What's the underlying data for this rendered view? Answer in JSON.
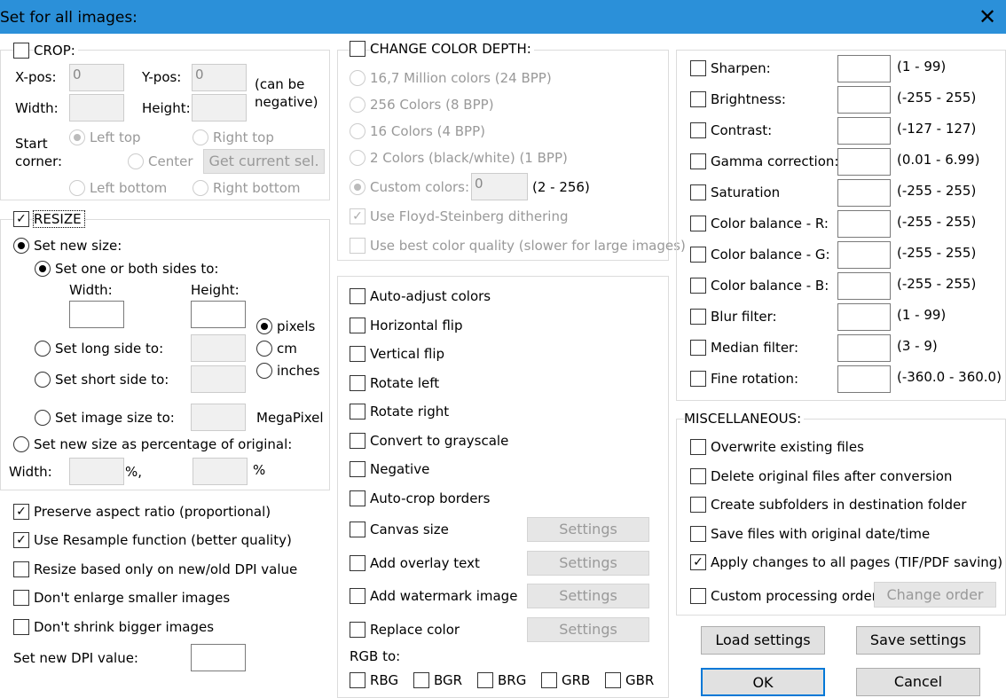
{
  "title": "Set for all images:",
  "crop": {
    "label": "CROP:",
    "xpos": "X-pos:",
    "xval": "0",
    "ypos": "Y-pos:",
    "yval": "0",
    "neg": "(can be",
    "neg2": "negative)",
    "width": "Width:",
    "height": "Height:",
    "start": "Start",
    "corner": "corner:",
    "lt": "Left top",
    "rt": "Right top",
    "center": "Center",
    "getsel": "Get current sel.",
    "lb": "Left bottom",
    "rbot": "Right bottom"
  },
  "resize": {
    "label": "RESIZE",
    "setnew": "Set new size:",
    "oneboth": "Set one or both sides to:",
    "width": "Width:",
    "height": "Height:",
    "pixels": "pixels",
    "cm": "cm",
    "inches": "inches",
    "longside": "Set long side to:",
    "shortside": "Set short side to:",
    "imgsize": "Set image size to:",
    "mp": "MegaPixel",
    "pct": "Set new size as percentage of original:",
    "pwidth": "Width:",
    "pctsign": "%,",
    "pctsign2": "%"
  },
  "opts": {
    "preserve": "Preserve aspect ratio (proportional)",
    "resample": "Use Resample function (better quality)",
    "dpionly": "Resize based only on new/old DPI value",
    "noenlarge": "Don't enlarge smaller images",
    "noshrink": "Don't shrink bigger images",
    "dpi": "Set new DPI value:"
  },
  "depth": {
    "label": "CHANGE COLOR DEPTH:",
    "c24": "16,7 Million colors (24 BPP)",
    "c8": "256 Colors (8 BPP)",
    "c4": "16 Colors (4 BPP)",
    "c1": "2 Colors (black/white) (1 BPP)",
    "custom": "Custom colors:",
    "customval": "0",
    "range": "(2 - 256)",
    "floyd": "Use Floyd-Steinberg dithering",
    "best": "Use best color quality (slower for large images)"
  },
  "actions": {
    "auto": "Auto-adjust colors",
    "hflip": "Horizontal flip",
    "vflip": "Vertical flip",
    "rleft": "Rotate left",
    "rright": "Rotate right",
    "gray": "Convert to grayscale",
    "neg": "Negative",
    "autocrop": "Auto-crop borders",
    "canvas": "Canvas size",
    "overlay": "Add overlay text",
    "watermark": "Add watermark image",
    "replace": "Replace color",
    "settings": "Settings",
    "rgbto": "RGB to:",
    "rbg": "RBG",
    "bgr": "BGR",
    "brg": "BRG",
    "grb": "GRB",
    "gbr": "GBR"
  },
  "adjust": [
    {
      "label": "Sharpen:",
      "range": "(1  -  99)"
    },
    {
      "label": "Brightness:",
      "range": "(-255  -  255)"
    },
    {
      "label": "Contrast:",
      "range": "(-127  -  127)"
    },
    {
      "label": "Gamma correction:",
      "range": "(0.01  -  6.99)"
    },
    {
      "label": "Saturation",
      "range": "(-255  -  255)"
    },
    {
      "label": "Color balance - R:",
      "range": "(-255  -  255)"
    },
    {
      "label": "Color balance - G:",
      "range": "(-255  -  255)"
    },
    {
      "label": "Color balance - B:",
      "range": "(-255  -  255)"
    },
    {
      "label": "Blur filter:",
      "range": "(1  -  99)"
    },
    {
      "label": "Median filter:",
      "range": "(3  -  9)"
    },
    {
      "label": "Fine rotation:",
      "range": "(-360.0  -  360.0)"
    }
  ],
  "misc": {
    "label": "MISCELLANEOUS:",
    "overwrite": "Overwrite existing files",
    "delete": "Delete original files after conversion",
    "subfolders": "Create subfolders in destination folder",
    "savedate": "Save files with original date/time",
    "allpages": "Apply changes to all pages (TIF/PDF saving)",
    "custom": "Custom processing order",
    "changeorder": "Change order"
  },
  "buttons": {
    "load": "Load settings",
    "save": "Save settings",
    "ok": "OK",
    "cancel": "Cancel"
  }
}
